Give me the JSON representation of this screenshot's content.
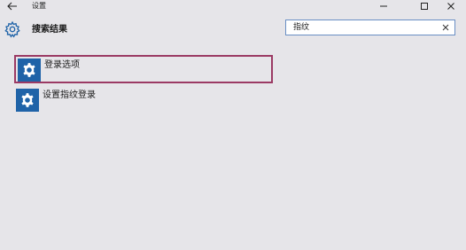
{
  "window": {
    "title": "设置",
    "back_icon": "arrow-left-icon",
    "controls": [
      "minimize-icon",
      "maximize-icon",
      "close-icon"
    ]
  },
  "header": {
    "title": "搜索结果",
    "icon": "gear-icon"
  },
  "search": {
    "value": "指纹",
    "clear_icon": "close-icon"
  },
  "results": [
    {
      "label": "登录选项",
      "icon": "gear-icon",
      "selected": true
    },
    {
      "label": "设置指纹登录",
      "icon": "gear-icon",
      "selected": false
    }
  ],
  "colors": {
    "background": "#e6e5e9",
    "icon_tile": "#1f63a8",
    "selection_border": "#9b3a64",
    "search_border": "#6a8ec4"
  }
}
